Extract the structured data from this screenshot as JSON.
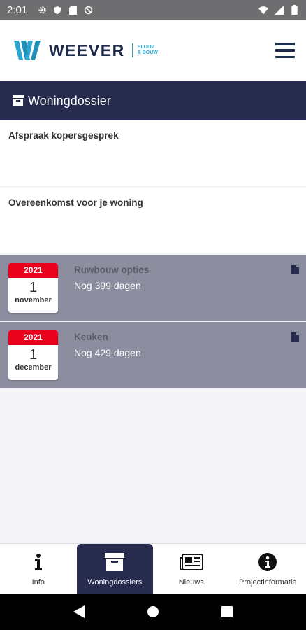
{
  "status_bar": {
    "time": "2:01"
  },
  "header": {
    "brand": "WEEVER",
    "tagline_line1": "SLOOP",
    "tagline_line2": "& BOUW"
  },
  "page": {
    "title": "Woningdossier"
  },
  "items": [
    {
      "title": "Afspraak kopersgesprek"
    },
    {
      "title": "Overeenkomst voor je woning"
    }
  ],
  "events": [
    {
      "year": "2021",
      "day": "1",
      "month": "november",
      "title": "Ruwbouw opties",
      "subtitle": "Nog 399 dagen"
    },
    {
      "year": "2021",
      "day": "1",
      "month": "december",
      "title": "Keuken",
      "subtitle": "Nog 429 dagen"
    }
  ],
  "bottom_nav": [
    {
      "label": "Info",
      "icon": "info-icon"
    },
    {
      "label": "Woningdossiers",
      "icon": "archive-icon",
      "active": true
    },
    {
      "label": "Nieuws",
      "icon": "newspaper-icon"
    },
    {
      "label": "Projectinformatie",
      "icon": "info-circle-icon"
    }
  ],
  "colors": {
    "navy": "#272c4f",
    "accent": "#2aa5cf",
    "event_bg": "#8c8d9f",
    "calendar_red": "#e8001c"
  }
}
